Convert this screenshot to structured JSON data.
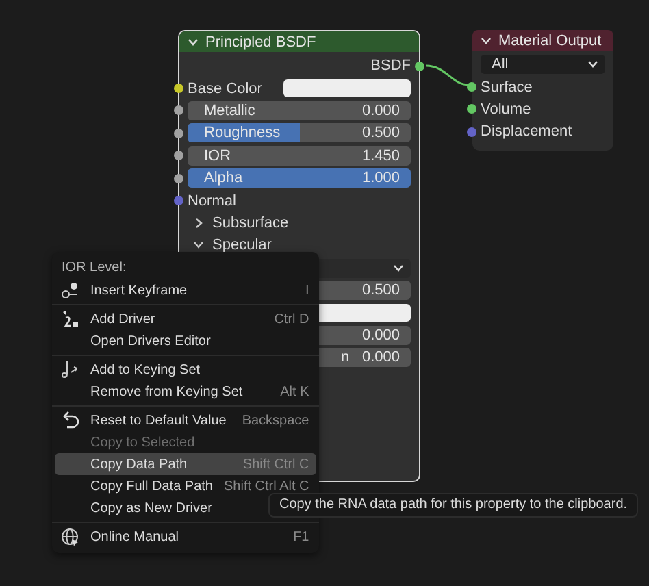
{
  "principled_node": {
    "title": "Principled BSDF",
    "expanded": true,
    "output": {
      "label": "BSDF",
      "color": "#63c763"
    },
    "inputs": [
      {
        "kind": "color",
        "label": "Base Color",
        "color": "#c7c729"
      },
      {
        "kind": "slider",
        "label": "Metallic",
        "value": "0.000",
        "level": 0,
        "color": "#a1a1a1"
      },
      {
        "kind": "slider",
        "label": "Roughness",
        "value": "0.500",
        "level": 0.5,
        "color": "#a1a1a1"
      },
      {
        "kind": "number",
        "label": "IOR",
        "value": "1.450",
        "color": "#a1a1a1"
      },
      {
        "kind": "slider",
        "label": "Alpha",
        "value": "1.000",
        "level": 1,
        "color": "#a1a1a1"
      },
      {
        "kind": "socket",
        "label": "Normal",
        "color": "#6363c7"
      },
      {
        "kind": "panel",
        "label": "Subsurface",
        "expanded": false
      },
      {
        "kind": "panel",
        "label": "Specular",
        "expanded": true
      },
      {
        "kind": "dropdown"
      },
      {
        "kind": "number",
        "value": "0.500"
      },
      {
        "kind": "color"
      },
      {
        "kind": "number",
        "value": "0.000"
      },
      {
        "kind": "number",
        "label": "n",
        "value": "0.000"
      }
    ]
  },
  "output_node": {
    "title": "Material Output",
    "expanded": true,
    "target": "All",
    "inputs": [
      {
        "label": "Surface",
        "color": "#63c763"
      },
      {
        "label": "Volume",
        "color": "#63c763"
      },
      {
        "label": "Displacement",
        "color": "#6363c7"
      }
    ]
  },
  "context_menu": {
    "title": "IOR Level:",
    "groups": [
      [
        {
          "label": "Insert Keyframe",
          "shortcut": "I",
          "kind": "keyframe",
          "disabled": false,
          "selected": false
        }
      ],
      [
        {
          "label": "Add Driver",
          "shortcut": "Ctrl D",
          "kind": "driver",
          "disabled": false,
          "selected": false
        },
        {
          "label": "Open Drivers Editor",
          "disabled": false,
          "selected": false
        }
      ],
      [
        {
          "label": "Add to Keying Set",
          "kind": "keying",
          "disabled": false,
          "selected": false
        },
        {
          "label": "Remove from Keying Set",
          "shortcut": "Alt K",
          "disabled": false,
          "selected": false
        }
      ],
      [
        {
          "label": "Reset to Default Value",
          "shortcut": "Backspace",
          "kind": "reset",
          "disabled": false,
          "selected": false
        },
        {
          "label": "Copy to Selected",
          "disabled": true,
          "selected": false
        },
        {
          "label": "Copy Data Path",
          "shortcut": "Shift Ctrl C",
          "disabled": false,
          "selected": true
        },
        {
          "label": "Copy Full Data Path",
          "shortcut": "Shift Ctrl Alt C",
          "disabled": false,
          "selected": false
        },
        {
          "label": "Copy as New Driver",
          "disabled": false,
          "selected": false
        }
      ],
      [
        {
          "label": "Online Manual",
          "shortcut": "F1",
          "kind": "globe",
          "disabled": false,
          "selected": false
        }
      ]
    ]
  },
  "tooltip": "Copy the RNA data path for this property to the clipboard."
}
